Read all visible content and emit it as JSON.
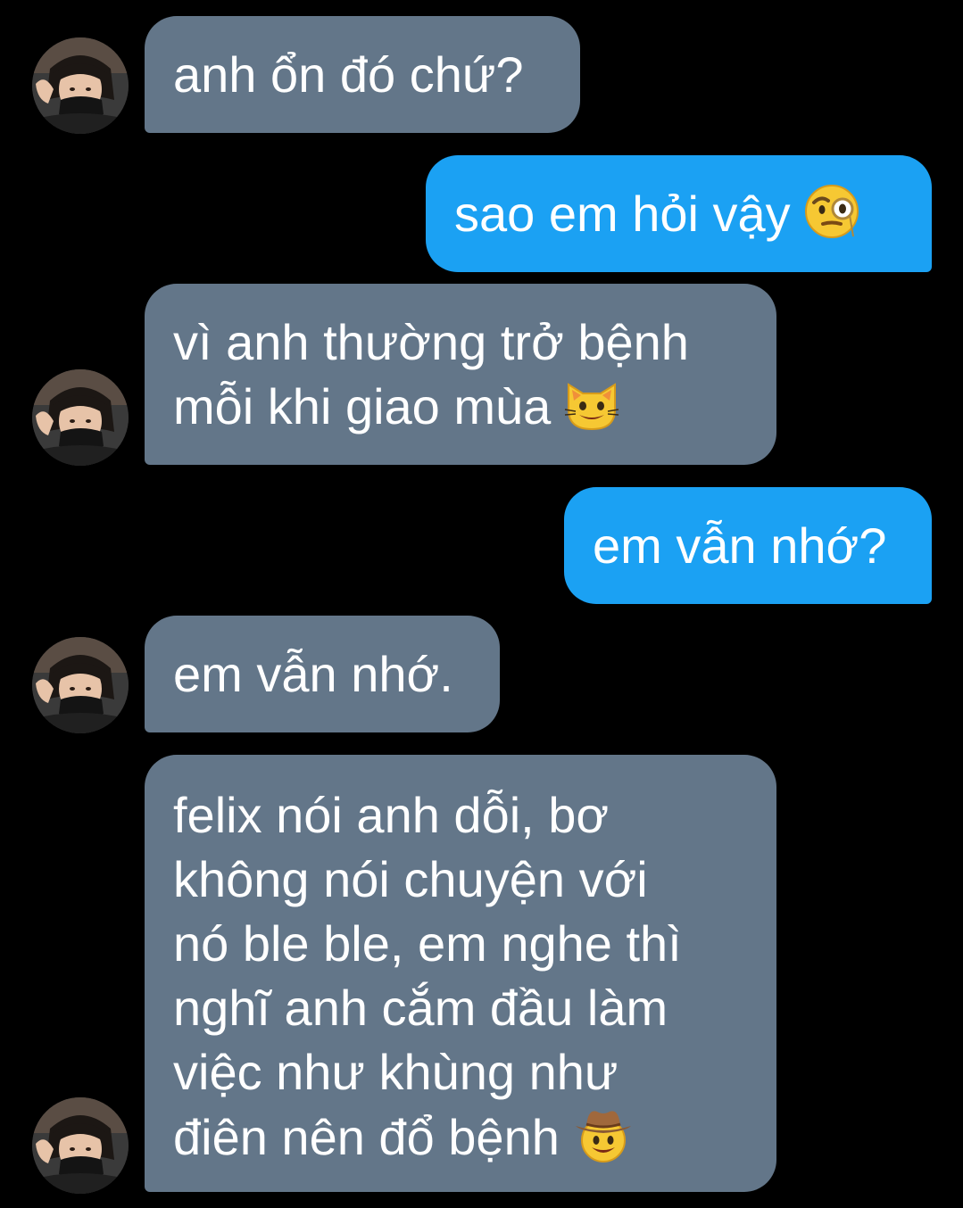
{
  "colors": {
    "background": "#000000",
    "incoming_bubble": "#637689",
    "outgoing_bubble": "#1ba1f3",
    "text": "#ffffff"
  },
  "messages": [
    {
      "direction": "incoming",
      "lines": [
        "anh ổn đó chứ?"
      ]
    },
    {
      "direction": "outgoing",
      "lines": [
        "sao em hỏi vậy"
      ],
      "emoji": "face-with-monocle"
    },
    {
      "direction": "incoming",
      "lines": [
        "vì anh thường trở bệnh",
        "mỗi khi giao mùa"
      ],
      "emoji": "grinning-cat-face"
    },
    {
      "direction": "outgoing",
      "lines": [
        "em vẫn nhớ?"
      ]
    },
    {
      "direction": "incoming",
      "lines": [
        "em vẫn nhớ."
      ]
    },
    {
      "direction": "incoming",
      "lines": [
        "felix nói anh dỗi, bơ",
        "không nói chuyện với",
        "nó ble ble, em nghe thì",
        "nghĩ anh cắm đầu làm",
        "việc như khùng như",
        "điên nên đổ bệnh"
      ],
      "emoji": "cowboy-hat-face"
    }
  ],
  "avatar": "contact-avatar-photo"
}
